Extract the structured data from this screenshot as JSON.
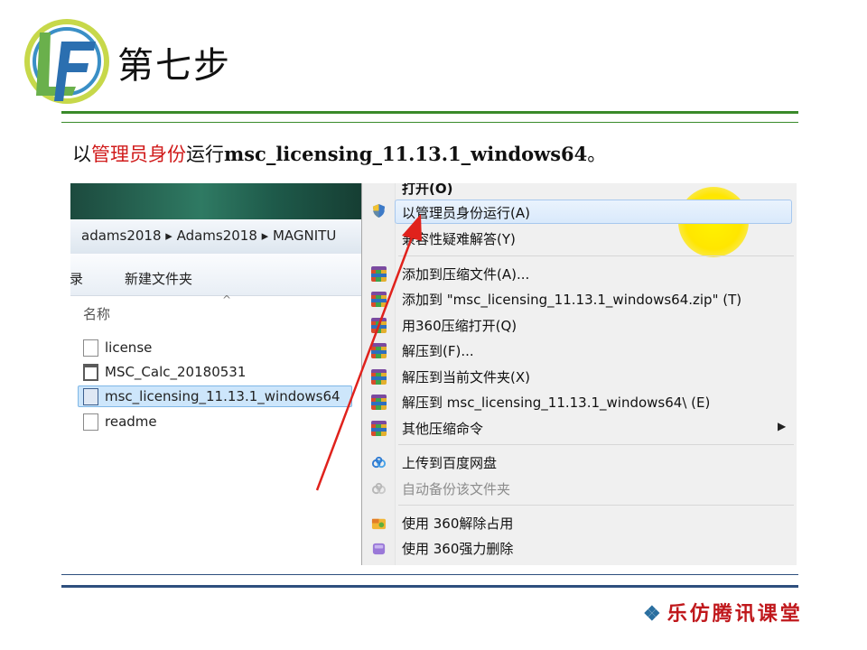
{
  "header": {
    "step_title": "第七步"
  },
  "instruction": {
    "prefix": "以",
    "highlight": "管理员身份",
    "mid": "运行",
    "filename": "msc_licensing_11.13.1_windows64",
    "suffix": "。"
  },
  "explorer": {
    "breadcrumb": "adams2018 ▸ Adams2018 ▸ MAGNITU",
    "toolbar": {
      "left_cut": "刻录",
      "new_folder": "新建文件夹"
    },
    "column_name": "名称",
    "files": [
      {
        "name": "license",
        "icon": "text-file-icon"
      },
      {
        "name": "MSC_Calc_20180531",
        "icon": "app-window-icon"
      },
      {
        "name": "msc_licensing_11.13.1_windows64",
        "icon": "script-file-icon",
        "selected": true
      },
      {
        "name": "readme",
        "icon": "text-file-icon"
      }
    ]
  },
  "context_menu": {
    "items": [
      {
        "label": "打开(O)"
      },
      {
        "label": "以管理员身份运行(A)",
        "icon": "uac-shield-icon",
        "highlighted": true
      },
      {
        "label": "兼容性疑难解答(Y)"
      },
      {
        "label": "添加到压缩文件(A)...",
        "icon": "winrar-icon"
      },
      {
        "label": "添加到 \"msc_licensing_11.13.1_windows64.zip\" (T)",
        "icon": "winrar-icon"
      },
      {
        "label": "用360压缩打开(Q)",
        "icon": "winrar-icon"
      },
      {
        "label": "解压到(F)...",
        "icon": "winrar-icon"
      },
      {
        "label": "解压到当前文件夹(X)",
        "icon": "winrar-icon"
      },
      {
        "label": "解压到 msc_licensing_11.13.1_windows64\\ (E)",
        "icon": "winrar-icon"
      },
      {
        "label": "其他压缩命令",
        "icon": "winrar-icon",
        "submenu": true
      },
      {
        "label": "上传到百度网盘",
        "icon": "baidu-cloud-icon"
      },
      {
        "label": "自动备份该文件夹",
        "icon": "baidu-cloud-icon",
        "disabled": true
      },
      {
        "label": "使用 360解除占用",
        "icon": "360-unlock-icon"
      },
      {
        "label": "使用 360强力删除",
        "icon": "360-delete-icon"
      }
    ]
  },
  "footer": {
    "brand": "乐仿腾讯课堂"
  },
  "colors": {
    "green_rule": "#3a8a2a",
    "blue_rule": "#2e4f7e",
    "highlight_red": "#d01a1a",
    "arrow_red": "#e0221c",
    "marker_yellow": "#ffe600"
  }
}
